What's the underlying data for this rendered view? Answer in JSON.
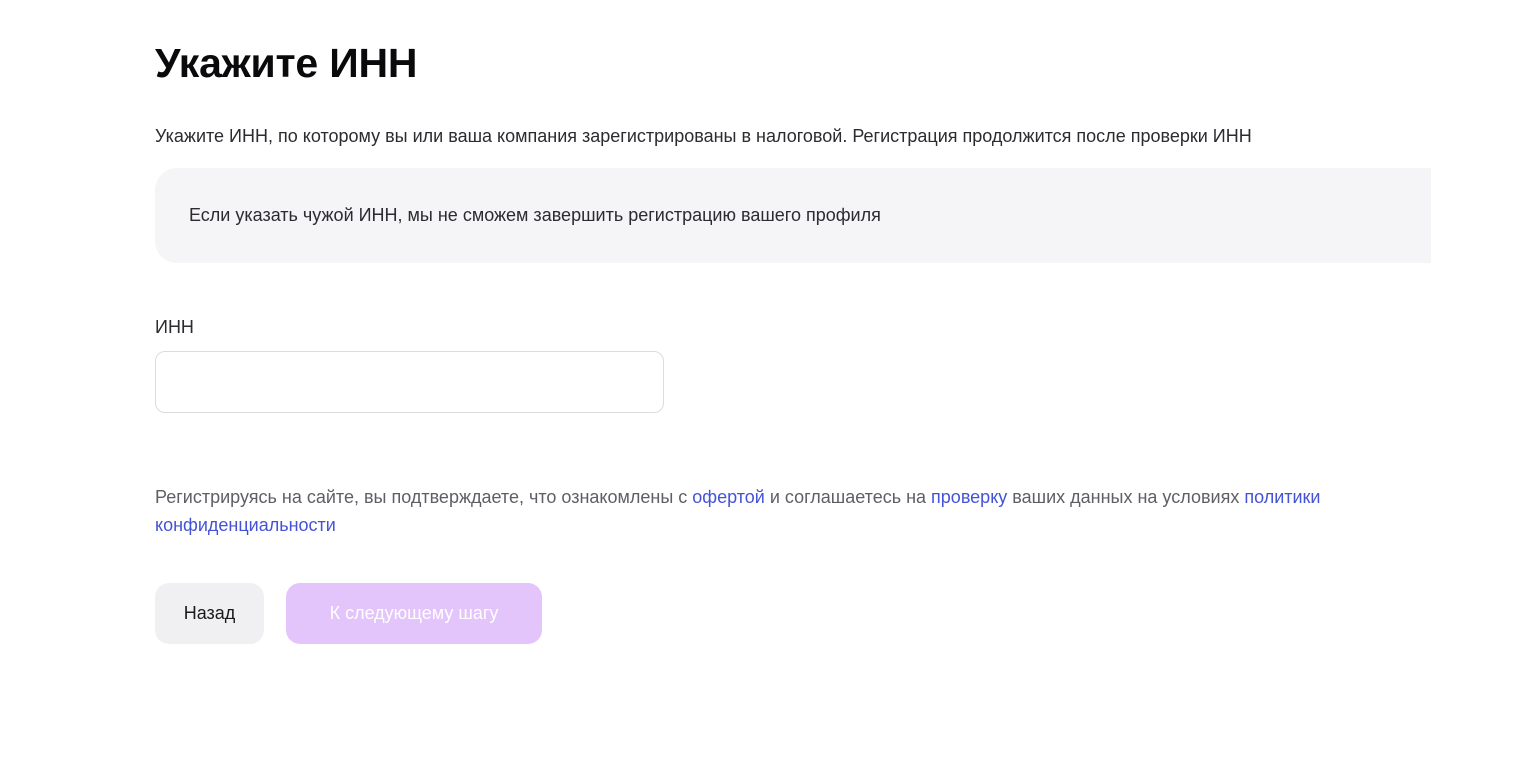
{
  "page": {
    "title": "Укажите ИНН",
    "description": "Укажите ИНН, по которому вы или ваша компания зарегистрированы в налоговой. Регистрация продолжится после проверки ИНН",
    "notice": "Если указать чужой ИНН, мы не сможем завершить регистрацию вашего профиля"
  },
  "inn_field": {
    "label": "ИНН",
    "value": "",
    "placeholder": ""
  },
  "terms": {
    "text_1": "Регистрируясь на сайте, вы подтверждаете, что ознакомлены с ",
    "offer_link": "офертой",
    "text_2": " и соглашаетесь на ",
    "check_link": "проверку",
    "text_3": " ваших данных на условиях ",
    "privacy_link": "политики конфиденциальности"
  },
  "actions": {
    "back_label": "Назад",
    "next_label": "К следующему шагу",
    "next_disabled": true
  },
  "colors": {
    "link": "#4453d6",
    "next_button_disabled": "#e3c4fb",
    "notice_background": "#f5f5f7",
    "back_button": "#f0f0f2"
  }
}
